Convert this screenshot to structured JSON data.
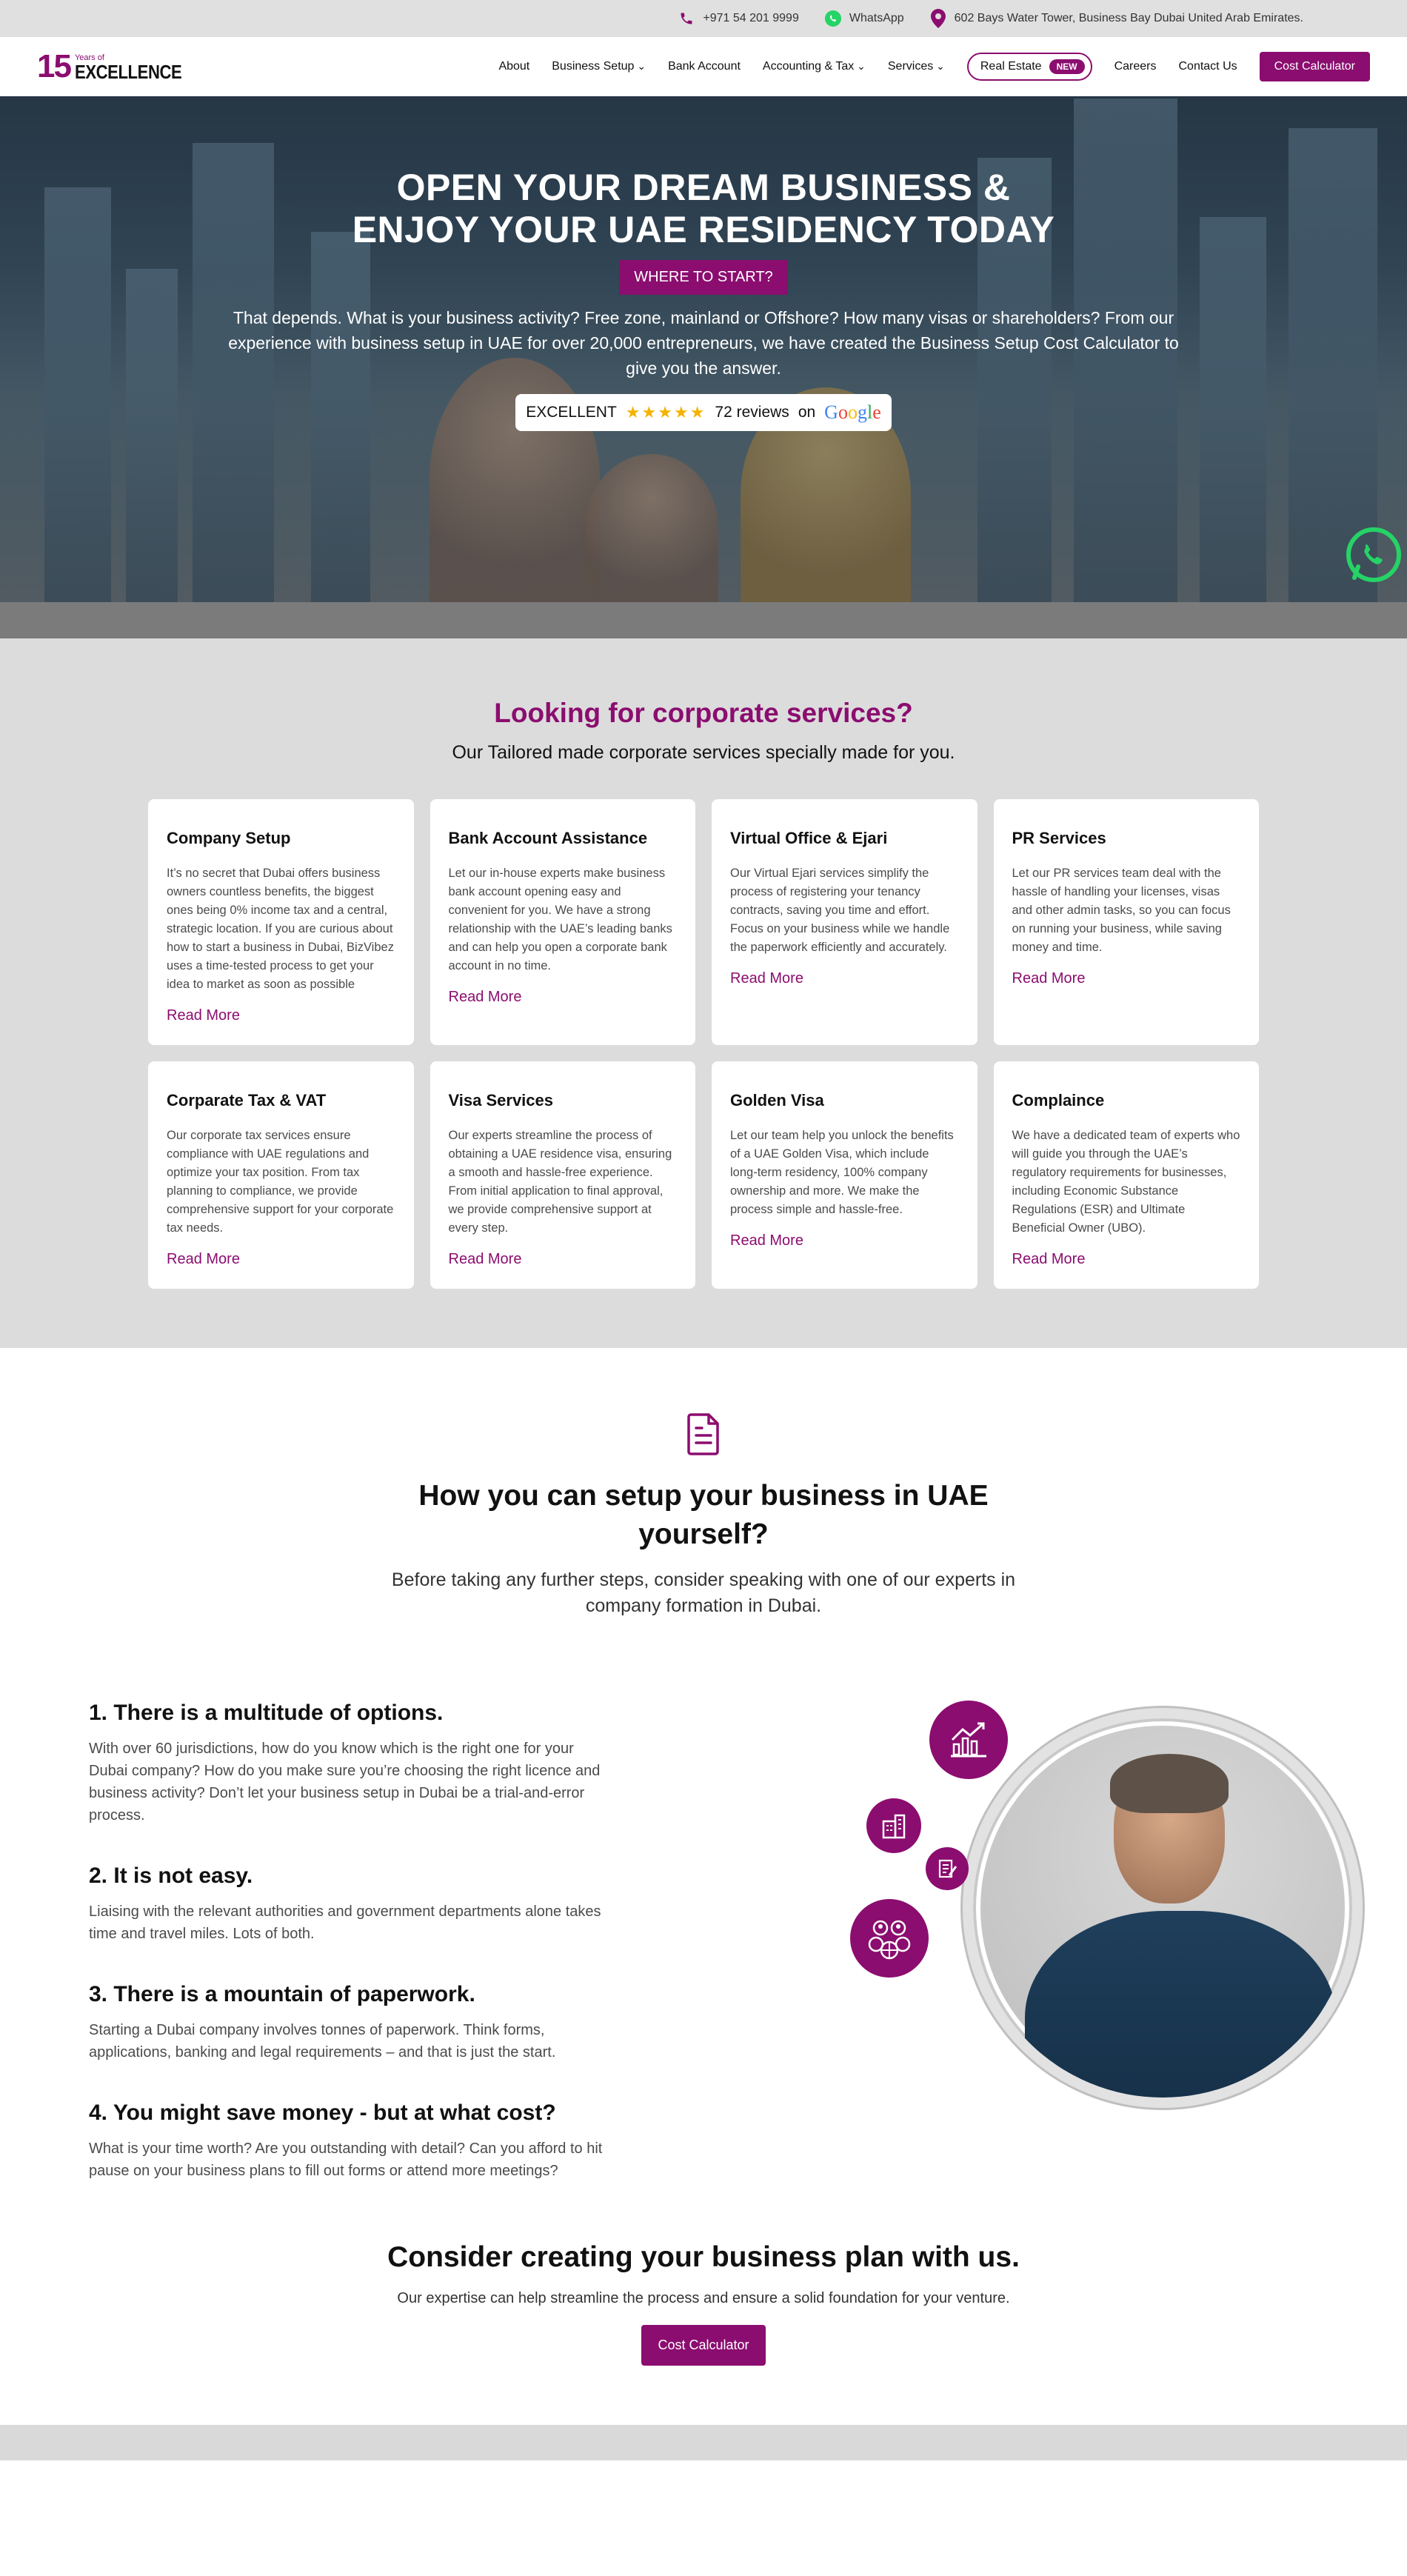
{
  "topbar": {
    "phone": "+971 54 201 9999",
    "whatsapp": "WhatsApp",
    "address": "602 Bays Water Tower, Business Bay Dubai United Arab Emirates."
  },
  "logo": {
    "number": "15",
    "years": "Years of",
    "word": "EXCELLENCE"
  },
  "nav": {
    "about": "About",
    "business_setup": "Business Setup",
    "bank_account": "Bank Account",
    "accounting": "Accounting & Tax",
    "services": "Services",
    "real_estate": "Real Estate",
    "new_badge": "NEW",
    "careers": "Careers",
    "contact": "Contact Us",
    "cost_calculator": "Cost Calculator"
  },
  "hero": {
    "title_line1": "OPEN YOUR DREAM BUSINESS &",
    "title_line2": "ENJOY YOUR UAE RESIDENCY TODAY",
    "cta": "WHERE TO START?",
    "text": "That depends. What is your business activity? Free zone, mainland or Offshore? How many visas or shareholders? From our experience with business setup in UAE for over 20,000 entrepreneurs, we have created the Business Setup Cost Calculator to give you the answer.",
    "rating_label": "EXCELLENT",
    "stars": "★★★★★",
    "rating_value": 5,
    "reviews": "72 reviews",
    "on": "on"
  },
  "services": {
    "title": "Looking for corporate services?",
    "subtitle": "Our Tailored made corporate services specially made for you.",
    "read_more": "Read More",
    "cards": [
      {
        "title": "Company Setup",
        "text": "It’s no secret that Dubai offers business owners countless benefits, the biggest ones being 0% income tax and a central, strategic location. If you are curious about how to start a business in Dubai, BizVibez uses a time-tested process to get your idea to market as soon as possible"
      },
      {
        "title": "Bank Account Assistance",
        "text": "Let our in-house experts make business bank account opening easy and convenient for you. We have a strong relationship with the UAE’s leading banks and can help you open a corporate bank account in no time."
      },
      {
        "title": "Virtual Office & Ejari",
        "text": "Our Virtual Ejari services simplify the process of registering your tenancy contracts, saving you time and effort. Focus on your business while we handle the paperwork efficiently and accurately."
      },
      {
        "title": "PR Services",
        "text": "Let our PR services team deal with the hassle of handling your licenses, visas and other admin tasks, so you can focus on running your business, while saving money and time."
      },
      {
        "title": "Corparate Tax & VAT",
        "text": "Our corporate tax services ensure compliance with UAE regulations and optimize your tax position. From tax planning to compliance, we provide comprehensive support for your corporate tax needs."
      },
      {
        "title": "Visa Services",
        "text": "Our experts streamline the process of obtaining a UAE residence visa, ensuring a smooth and hassle-free experience. From initial application to final approval, we provide comprehensive support at every step."
      },
      {
        "title": "Golden Visa",
        "text": "Let our team help you unlock the benefits of a UAE Golden Visa, which include long-term residency, 100% company ownership and more. We make the process simple and hassle-free."
      },
      {
        "title": "Complaince",
        "text": "We have a dedicated team of experts who will guide you through the UAE’s regulatory requirements for businesses, including Economic Substance Regulations (ESR) and Ultimate Beneficial Owner (UBO)."
      }
    ]
  },
  "how": {
    "title_line1": "How you can setup your business in UAE",
    "title_line2": "yourself?",
    "lead_line1": "Before taking any further steps, consider speaking with one of our experts in",
    "lead_line2": "company formation in Dubai.",
    "steps": [
      {
        "title": "1. There is a multitude of options.",
        "text": "With over 60 jurisdictions, how do you know which is the right one for your Dubai company? How do you make sure you’re choosing the right licence and business activity? Don’t let your business setup in Dubai be a trial-and-error process."
      },
      {
        "title": "2. It is not easy.",
        "text": "Liaising with the relevant authorities and government departments alone takes time and travel miles. Lots of both."
      },
      {
        "title": "3. There is a mountain of paperwork.",
        "text": "Starting a Dubai company involves tonnes of paperwork. Think forms, applications, banking and legal requirements – and that is just the start."
      },
      {
        "title": "4. You might save money - but at what cost?",
        "text": "What is your time worth? Are you outstanding with detail? Can you afford to hit pause on your business plans to fill out forms or attend more meetings?"
      }
    ]
  },
  "cta": {
    "title": "Consider creating your business plan with us.",
    "text": "Our expertise can help streamline the process and ensure a solid foundation for your venture.",
    "button": "Cost Calculator"
  },
  "colors": {
    "brand": "#8b0d6f",
    "whatsapp": "#25d366"
  }
}
